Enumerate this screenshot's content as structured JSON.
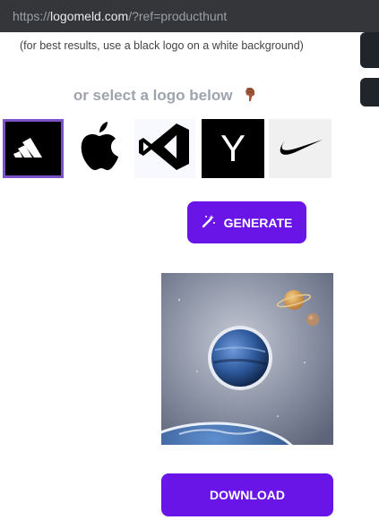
{
  "browser": {
    "url_prefix": "https://",
    "url_domain": "logomeld.com",
    "url_suffix": "/?ref=producthunt"
  },
  "hint_text": "(for best results, use a black logo on a white background)",
  "select_title": "or select a logo below",
  "logos": [
    {
      "name": "adidas",
      "icon": "adidas-icon",
      "selected": true
    },
    {
      "name": "apple",
      "icon": "apple-icon",
      "selected": false
    },
    {
      "name": "vscode",
      "icon": "vscode-icon",
      "selected": false
    },
    {
      "name": "ycombinator",
      "icon": "y-letter-icon",
      "letter": "Y",
      "selected": false
    },
    {
      "name": "nike",
      "icon": "swoosh-icon",
      "selected": false
    }
  ],
  "generate_label": "GENERATE",
  "download_label": "DOWNLOAD",
  "colors": {
    "accent": "#6a15e8",
    "selected_border": "#7b52c8",
    "urlbar": "#35363a"
  }
}
